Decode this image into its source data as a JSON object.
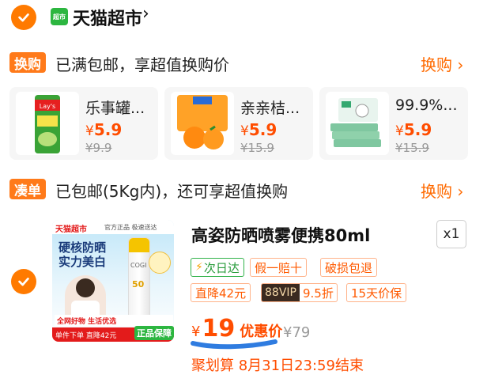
{
  "store": {
    "icon": "tmall-supermarket-icon",
    "icon_label": "超市",
    "name": "天猫超市",
    "chevron": "›"
  },
  "exchange_section": {
    "tag": "换购",
    "text": "已满包邮，享超值换购价",
    "link": "换购 ›",
    "items": [
      {
        "name": "乐事罐...",
        "currency": "¥",
        "price": "5.9",
        "old_price": "¥9.9"
      },
      {
        "name": "亲亲桔...",
        "currency": "¥",
        "price": "5.9",
        "old_price": "¥15.9"
      },
      {
        "name": "99.9%...",
        "currency": "¥",
        "price": "5.9",
        "old_price": "¥15.9"
      }
    ]
  },
  "addon_section": {
    "tag": "凑单",
    "text": "已包邮(5Kg内)，还可享超值换购",
    "link": "换购 ›"
  },
  "product": {
    "title": "高姿防晒喷雾便携80ml",
    "qty": "x1",
    "image": {
      "brand": "天猫超市",
      "brand_sub": "官方正品 极速送达",
      "headline1": "硬核防晒",
      "headline2": "实力美白",
      "bottle_brand": "COGI",
      "spf": "50",
      "promo1": "全网好物 生活优选",
      "promo2": "单件下单 直降42元",
      "guarantee": "正品保障"
    },
    "badges": {
      "next_day": "次日达",
      "fake_refund": "假一赔十",
      "damage_refund": "破损包退",
      "discount": "直降42元",
      "vip": "88VIP",
      "vip_discount": "9.5折",
      "price_protect": "15天价保"
    },
    "currency": "¥",
    "price": "19",
    "price_label": "优惠价",
    "orig_price": "¥79",
    "deal": "聚划算 8月31日23:59结束"
  },
  "colors": {
    "accent": "#ff6a00",
    "check": "#ff7a00",
    "price": "#ff4d00",
    "underline": "#2f7ce0"
  }
}
